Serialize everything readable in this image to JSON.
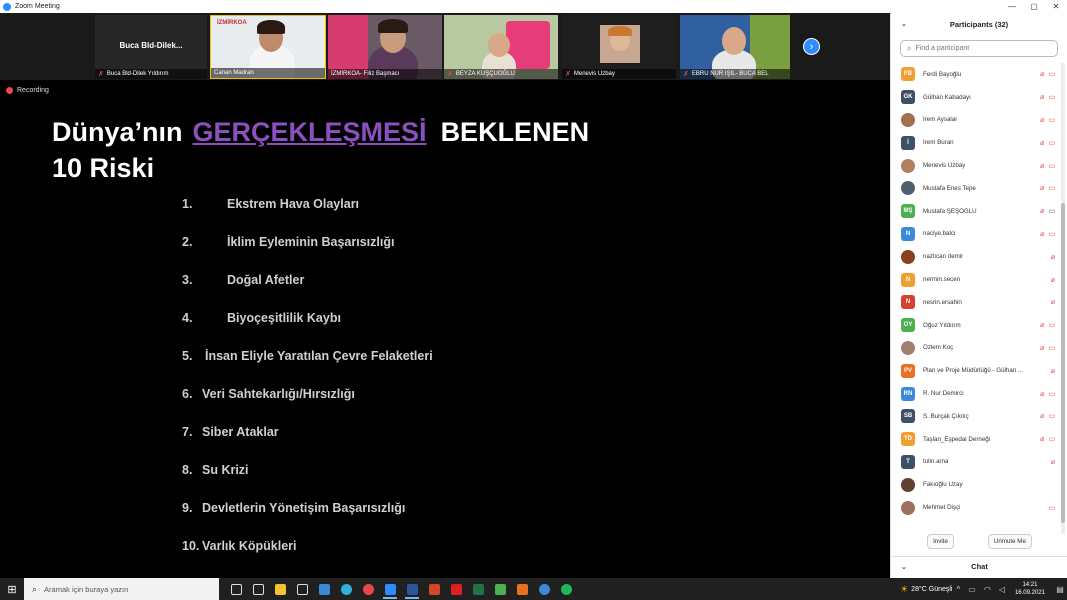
{
  "window": {
    "title": "Zoom Meeting",
    "controls": [
      "—",
      "▢",
      "✕"
    ]
  },
  "video_strip": {
    "tiles": [
      {
        "name": "Buca Bld-Dilek Yıldırım",
        "center_label": "Buca Bld-Dilek...",
        "muted": true,
        "has_video": false
      },
      {
        "name": "Canan Madran",
        "center_label": "",
        "muted": false,
        "has_video": true,
        "logo": "İZMİRKOA"
      },
      {
        "name": "İZMİRKOA- Filiz Başmacı",
        "center_label": "",
        "muted": false,
        "has_video": true
      },
      {
        "name": "BEYZA KUŞÇUOĞLU",
        "center_label": "",
        "muted": true,
        "has_video": true
      },
      {
        "name": "Menevis Uzbay",
        "center_label": "",
        "muted": true,
        "has_video": true
      },
      {
        "name": "EBRU NUR IŞIL- BUCA BEL",
        "center_label": "",
        "muted": true,
        "has_video": true
      }
    ],
    "next_icon": "chevron-right-icon"
  },
  "slide": {
    "recording_label": "Recording",
    "title_part1": "Dünya’nın",
    "title_highlight": "GERÇEKLEŞMESİ",
    "title_part2": "BEKLENEN",
    "title_line2": "10 Riski",
    "risks": [
      {
        "num": "1.",
        "text": "Ekstrem Hava Olayları"
      },
      {
        "num": "2.",
        "text": "İklim Eyleminin Başarısızlığı"
      },
      {
        "num": "3.",
        "text": "Doğal  Afetler"
      },
      {
        "num": "4.",
        "text": "Biyoçeşitlilik Kaybı"
      },
      {
        "num": "5.",
        "text": "İnsan Eliyle Yaratılan Çevre Felaketleri"
      },
      {
        "num": "6.",
        "text": "Veri Sahtekarlığı/Hırsızlığı"
      },
      {
        "num": "7.",
        "text": "Siber Ataklar"
      },
      {
        "num": "8.",
        "text": "Su Krizi"
      },
      {
        "num": "9.",
        "text": "Devletlerin Yönetişim Başarısızlığı"
      },
      {
        "num": "10.",
        "text": "Varlık Köpükleri"
      }
    ]
  },
  "participants": {
    "header": "Participants (32)",
    "search_placeholder": "Find a participant",
    "list": [
      {
        "initials": "FB",
        "color": "#f0a030",
        "name": "Ferdi Bayoğlu",
        "mic_muted": true,
        "cam_off": true,
        "photo": false
      },
      {
        "initials": "GK",
        "color": "#3c5068",
        "name": "Gülhan Kabadayı",
        "mic_muted": true,
        "cam_off": true,
        "photo": false
      },
      {
        "initials": "",
        "color": "#a07050",
        "name": "İrem Aysalar",
        "mic_muted": true,
        "cam_off": true,
        "photo": true
      },
      {
        "initials": "İ",
        "color": "#3c5068",
        "name": "İrem Buran",
        "mic_muted": true,
        "cam_off": true,
        "photo": false
      },
      {
        "initials": "",
        "color": "#b08060",
        "name": "Menevis Uzbay",
        "mic_muted": true,
        "cam_off": true,
        "photo": true
      },
      {
        "initials": "",
        "color": "#506070",
        "name": "Mustafa Enes Tepe",
        "mic_muted": true,
        "cam_off": true,
        "photo": true
      },
      {
        "initials": "MŞ",
        "color": "#4caf50",
        "name": "Mustafa ŞEŞOĞLU",
        "mic_muted": true,
        "cam_off": false,
        "photo": false
      },
      {
        "initials": "N",
        "color": "#3a8ad8",
        "name": "naciye.balci",
        "mic_muted": true,
        "cam_off": true,
        "photo": false
      },
      {
        "initials": "",
        "color": "#8a4020",
        "name": "nazlıcan demir",
        "mic_muted": true,
        "cam_off": null,
        "photo": true
      },
      {
        "initials": "N",
        "color": "#f0a030",
        "name": "nermin.secen",
        "mic_muted": true,
        "cam_off": null,
        "photo": false
      },
      {
        "initials": "N",
        "color": "#d84030",
        "name": "nesrin.ersahin",
        "mic_muted": true,
        "cam_off": null,
        "photo": false
      },
      {
        "initials": "OY",
        "color": "#4caf50",
        "name": "Oğuz Yıldırım",
        "mic_muted": true,
        "cam_off": true,
        "photo": false
      },
      {
        "initials": "",
        "color": "#a08070",
        "name": "Özlem Koç",
        "mic_muted": true,
        "cam_off": true,
        "photo": true
      },
      {
        "initials": "PV",
        "color": "#e87020",
        "name": "Plan ve Proje Müdürlüğü - Gülhan ...",
        "mic_muted": true,
        "cam_off": null,
        "photo": false
      },
      {
        "initials": "RN",
        "color": "#3a8ad8",
        "name": "R. Nur Demirci",
        "mic_muted": true,
        "cam_off": true,
        "photo": false
      },
      {
        "initials": "SB",
        "color": "#3c5068",
        "name": "S. Burçak Çıkılıç",
        "mic_muted": true,
        "cam_off": true,
        "photo": false
      },
      {
        "initials": "TD",
        "color": "#f0a030",
        "name": "Taşlan_Eşpedal Derneği",
        "mic_muted": true,
        "cam_off": true,
        "photo": false
      },
      {
        "initials": "T",
        "color": "#3c5068",
        "name": "tulin.arna",
        "mic_muted": true,
        "cam_off": null,
        "photo": false
      },
      {
        "initials": "",
        "color": "#604030",
        "name": "Fakıoğlu Uzay",
        "mic_muted": false,
        "cam_off": null,
        "photo": true
      },
      {
        "initials": "",
        "color": "#a07060",
        "name": "Mehmet Dişçi",
        "mic_muted": false,
        "cam_off": true,
        "photo": true
      }
    ],
    "invite_label": "Invite",
    "unmute_label": "Unmute Me"
  },
  "chat": {
    "header": "Chat"
  },
  "taskbar": {
    "search_placeholder": "Aramak için buraya yazın",
    "weather": "28°C  Güneşli",
    "time": "14:21",
    "date": "16.09.2021",
    "apps": [
      {
        "name": "task-view-icon",
        "color": "#dddddd",
        "active": false
      },
      {
        "name": "widgets-icon",
        "color": "#dddddd",
        "active": false
      },
      {
        "name": "file-explorer-icon",
        "color": "#f4c430",
        "active": false
      },
      {
        "name": "store-icon",
        "color": "#dddddd",
        "active": false
      },
      {
        "name": "mail-icon",
        "color": "#3a8ad8",
        "active": false
      },
      {
        "name": "edge-icon",
        "color": "#2fb0d8",
        "active": false
      },
      {
        "name": "chrome-icon",
        "color": "#e8484d",
        "active": false
      },
      {
        "name": "zoom-icon",
        "color": "#2d8cff",
        "active": true
      },
      {
        "name": "word-icon",
        "color": "#2b579a",
        "active": true
      },
      {
        "name": "powerpoint-icon",
        "color": "#d24726",
        "active": false
      },
      {
        "name": "acrobat-icon",
        "color": "#e02020",
        "active": false
      },
      {
        "name": "excel-icon",
        "color": "#217346",
        "active": false
      },
      {
        "name": "green-app-icon",
        "color": "#4caf50",
        "active": false
      },
      {
        "name": "paint-icon",
        "color": "#e87020",
        "active": false
      },
      {
        "name": "photos-icon",
        "color": "#3a8ad8",
        "active": false
      },
      {
        "name": "spotify-icon",
        "color": "#1db954",
        "active": false
      }
    ]
  },
  "colors": {
    "zoom_blue": "#2d8cff",
    "muted_red": "#e8484d",
    "highlight_purple": "#8b4fbf"
  }
}
